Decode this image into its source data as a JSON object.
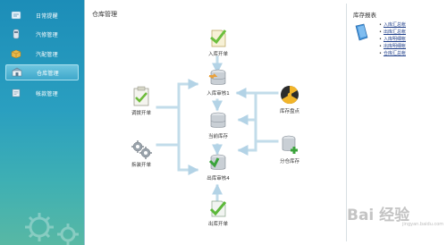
{
  "sidebar": {
    "items": [
      {
        "label": "日常提醒",
        "icon": "bell-icon"
      },
      {
        "label": "汽修管理",
        "icon": "car-icon"
      },
      {
        "label": "汽配管理",
        "icon": "parts-box-icon"
      },
      {
        "label": "仓库管理",
        "icon": "warehouse-icon",
        "active": true
      },
      {
        "label": "帐款管理",
        "icon": "account-icon"
      }
    ]
  },
  "main": {
    "title": "仓库管理",
    "flow": {
      "stock_in_order": "入库开单",
      "stock_in_audit": "入库审核1",
      "current_stock": "当前库存",
      "stock_out_audit": "出库审核4",
      "stock_out_order": "出库开单",
      "transfer_order": "调拨开单",
      "disassembly_order": "拆装开单",
      "stocktake": "库存盘点",
      "branch_stock": "分仓库存"
    }
  },
  "reports": {
    "title": "库存报表",
    "links": [
      "入库汇总帐",
      "出库汇总帐",
      "入库明细帐",
      "出库明细帐",
      "仓库汇总帐"
    ]
  },
  "watermark": {
    "text": "Bai 经验",
    "sub": "jingyan.baidu.com"
  },
  "colors": {
    "sidebar_top": "#1c8db8",
    "sidebar_bottom": "#58b8a4",
    "arrow": "#b9d7e8",
    "link": "#1f3f8a"
  }
}
